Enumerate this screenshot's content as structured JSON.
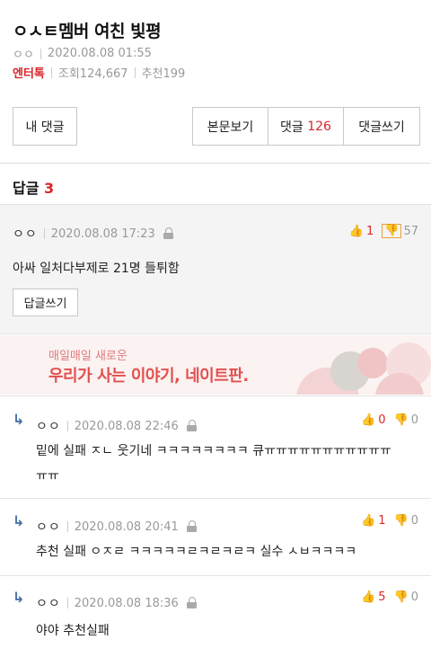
{
  "post": {
    "title": "ㅇㅅㅌ멤버 여친 빛평",
    "author": "ㅇㅇ",
    "datetime": "2020.08.08 01:55",
    "category": "엔터톡",
    "views_label": "조회124,667",
    "recommend_label": "추천199"
  },
  "buttons": {
    "my_comments": "내 댓글",
    "view_body": "본문보기",
    "comments_label": "댓글",
    "comments_count": "126",
    "write_comment": "댓글쓰기"
  },
  "replies": {
    "heading": "답글",
    "count": "3"
  },
  "main_comment": {
    "nick": "ㅇㅇ",
    "datetime": "2020.08.08 17:23",
    "text": "아싸 일처다부제로 21명 들튀함",
    "up": "1",
    "down": "57",
    "reply_button": "답글쓰기"
  },
  "ad": {
    "line1": "매일매일 새로운",
    "line2": "우리가 사는 이야기, 네이트판."
  },
  "sub_comments": [
    {
      "nick": "ㅇㅇ",
      "datetime": "2020.08.08 22:46",
      "text_line1": "밑에 실패 ㅈㄴ 웃기네 ㅋㅋㅋㅋㅋㅋㅋㅋ 큐ㅠㅠㅠㅠㅠㅠㅠㅠㅠㅠㅠ",
      "text_line2": "ㅠㅠ",
      "up": "0",
      "down": "0"
    },
    {
      "nick": "ㅇㅇ",
      "datetime": "2020.08.08 20:41",
      "text_line1": "추천 실패 ㅇㅈㄹ ㅋㅋㅋㅋㅋㄹㅋㄹㅋㄹㅋ 실수 ㅅㅂㅋㅋㅋㅋ",
      "up": "1",
      "down": "0"
    },
    {
      "nick": "ㅇㅇ",
      "datetime": "2020.08.08 18:36",
      "text_line1": "야야 추천실패",
      "up": "5",
      "down": "0"
    }
  ],
  "colors": {
    "accent_red": "#d9262b",
    "reply_arrow": "#4a6fa5"
  }
}
